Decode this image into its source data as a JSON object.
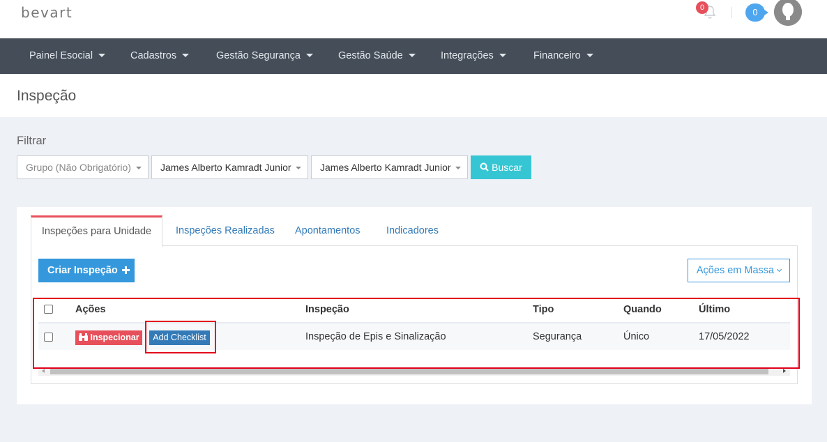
{
  "header": {
    "logo": "bevart",
    "notifications_count": "0",
    "messages_count": "0",
    "icons": [
      "bell-icon",
      "user-avatar"
    ]
  },
  "nav": {
    "items": [
      {
        "label": "Painel Esocial"
      },
      {
        "label": "Cadastros"
      },
      {
        "label": "Gestão Segurança"
      },
      {
        "label": "Gestão Saúde"
      },
      {
        "label": "Integrações"
      },
      {
        "label": "Financeiro"
      }
    ]
  },
  "page": {
    "title": "Inspeção"
  },
  "filter": {
    "label": "Filtrar",
    "group_select": "Grupo (Não Obrigatório)",
    "select_2": "James Alberto Kamradt Junior",
    "select_3": "James Alberto Kamradt Junior",
    "search_button": "Buscar"
  },
  "tabs": [
    {
      "label": "Inspeções para Unidade",
      "active": true
    },
    {
      "label": "Inspeções Realizadas"
    },
    {
      "label": "Apontamentos"
    },
    {
      "label": "Indicadores"
    }
  ],
  "toolbar": {
    "create_button": "Criar Inspeção",
    "bulk_actions": "Ações em Massa"
  },
  "table": {
    "headers": {
      "actions": "Ações",
      "inspection": "Inspeção",
      "type": "Tipo",
      "when": "Quando",
      "last": "Último"
    },
    "rows": [
      {
        "inspect_button": "Inspecionar",
        "add_checklist_button": "Add Checklist",
        "inspection": "Inspeção de Epis e Sinalização",
        "type": "Segurança",
        "when": "Único",
        "last": "17/05/2022"
      }
    ]
  },
  "colors": {
    "accent": "#3598dc",
    "cyan": "#36c6d3",
    "danger": "#e7505a",
    "nav_bg": "#444d58",
    "highlight": "#e3001b"
  }
}
